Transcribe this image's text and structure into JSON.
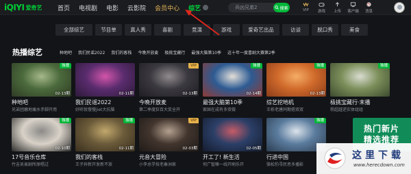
{
  "header": {
    "logo": "iQIYI",
    "logo_sub": "爱奇艺",
    "nav": [
      {
        "label": "首页"
      },
      {
        "label": "电视剧"
      },
      {
        "label": "电影"
      },
      {
        "label": "云影院"
      },
      {
        "label": "会员中心"
      },
      {
        "label": "综艺"
      }
    ],
    "search_placeholder": "兵凶兄弟2",
    "search_button": "搜索",
    "tools": [
      {
        "label": "VIP",
        "icon": "vip-icon"
      },
      {
        "label": "游戏",
        "icon": "game-icon"
      },
      {
        "label": "上传",
        "icon": "upload-icon"
      },
      {
        "label": "客户端",
        "icon": "client-icon"
      },
      {
        "label": "消息",
        "icon": "message-icon"
      }
    ]
  },
  "categories": [
    "全部综艺",
    "节目单",
    "真人秀",
    "喜剧",
    "竞演",
    "游戏",
    "爱奇艺出品",
    "访谈",
    "脱口秀",
    "美食"
  ],
  "section": {
    "title": "热播综艺",
    "links": [
      "种地吧",
      "我们民谣2022",
      "我们的客栈",
      "今晚开放麦",
      "极挑宝藏行",
      "最强大脑第10季",
      "这十年一度喜剧大赛第2季"
    ]
  },
  "cards": [
    {
      "title": "种地吧",
      "desc": "兄弟团磨地痛水手脚开用",
      "badge": "独播",
      "badge_type": "green",
      "date": "02-13期",
      "bg": [
        "#4b6a3c",
        "#a6b88a",
        "#2f3c25"
      ]
    },
    {
      "title": "我们民谣2022",
      "desc": "好听就慢慢jiet大抗脑",
      "badge": "",
      "badge_type": "",
      "date": "02-11期",
      "bg": [
        "#5a2c6e",
        "#d255a9",
        "#2d1a3a"
      ]
    },
    {
      "title": "今晚开放麦",
      "desc": "第二季度狂百大奖全开",
      "badge": "VIP",
      "badge_type": "vip",
      "date": "02-13期",
      "bg": [
        "#3b3940",
        "#8f8a8c",
        "#1e1d22"
      ]
    },
    {
      "title": "最强大脑第10季",
      "desc": "家国在成有多双做",
      "badge": "独播",
      "badge_type": "green",
      "date": "02-14期",
      "bg": [
        "#2d5b93",
        "#e3ded8",
        "#8f3a35"
      ]
    },
    {
      "title": "综艺挖地机",
      "desc": "王栋老唐同期搭双双",
      "badge": "独播",
      "badge_type": "green",
      "date": "02-13期",
      "bg": [
        "#d06a2b",
        "#f5ad66",
        "#8a3c1a"
      ]
    },
    {
      "title": "极挑宝藏行·末播",
      "desc": "杨超越逆实体组组",
      "badge": "独播",
      "badge_type": "green",
      "date": "",
      "bg": [
        "#7c8f5a",
        "#d8dcd0",
        "#3b4a2e"
      ]
    },
    {
      "title": "17号音乐仓库",
      "desc": "竹吉吴易剧所原唱过",
      "badge": "独播",
      "badge_type": "green",
      "date": "02-10期",
      "bg": [
        "#d8d2c8",
        "#8b8a88",
        "#2c2b2a"
      ]
    },
    {
      "title": "我们的客栈",
      "desc": "王子异新开发新不放",
      "badge": "独播",
      "badge_type": "green",
      "date": "02-11期",
      "bg": [
        "#6b5b3a",
        "#c2a86d",
        "#3a2f1f"
      ]
    },
    {
      "title": "元音大冒险",
      "desc": "小李总学技老秦洲家",
      "badge": "VIP",
      "badge_type": "vip",
      "date": "02-03期",
      "bg": [
        "#42352e",
        "#b3a08f",
        "#1f1a17"
      ]
    },
    {
      "title": "开工了! 新生活",
      "desc": "何广智嘛一线开刷乐开",
      "badge": "",
      "badge_type": "",
      "date": "02-05期",
      "bg": [
        "#2b3f67",
        "#c65c68",
        "#151c2e"
      ]
    },
    {
      "title": "行进中国",
      "desc": "骆松豹寻民思多播影",
      "badge": "独播",
      "badge_type": "green",
      "date": "",
      "bg": [
        "#5b7c9e",
        "#dbe3eb",
        "#2c3d50"
      ]
    }
  ],
  "ad": {
    "line1": "热门新片",
    "line2": "精选推荐"
  },
  "watermark": {
    "text": "这里下载",
    "url": "www.herecdown.com"
  }
}
